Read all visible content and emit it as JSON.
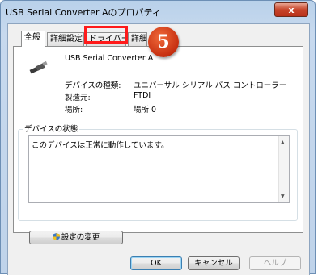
{
  "window": {
    "title": "USB Serial Converter Aのプロパティ",
    "close_label": "x"
  },
  "tabs": [
    {
      "label": "全般",
      "active": true
    },
    {
      "label": "詳細設定",
      "active": false
    },
    {
      "label": "ドライバー",
      "active": false
    },
    {
      "label": "詳細",
      "active": false
    }
  ],
  "device": {
    "name": "USB Serial Converter A",
    "type_label": "デバイスの種類:",
    "type_value": "ユニバーサル シリアル バス コントローラー",
    "manufacturer_label": "製造元:",
    "manufacturer_value": "FTDI",
    "location_label": "場所:",
    "location_value": "場所 0"
  },
  "status": {
    "group_label": "デバイスの状態",
    "text": "このデバイスは正常に動作しています。"
  },
  "buttons": {
    "change_settings": "設定の変更",
    "ok": "OK",
    "cancel": "キャンセル",
    "help": "ヘルプ"
  },
  "annotation": {
    "step_number": "5",
    "color": "#ff1a1a"
  }
}
